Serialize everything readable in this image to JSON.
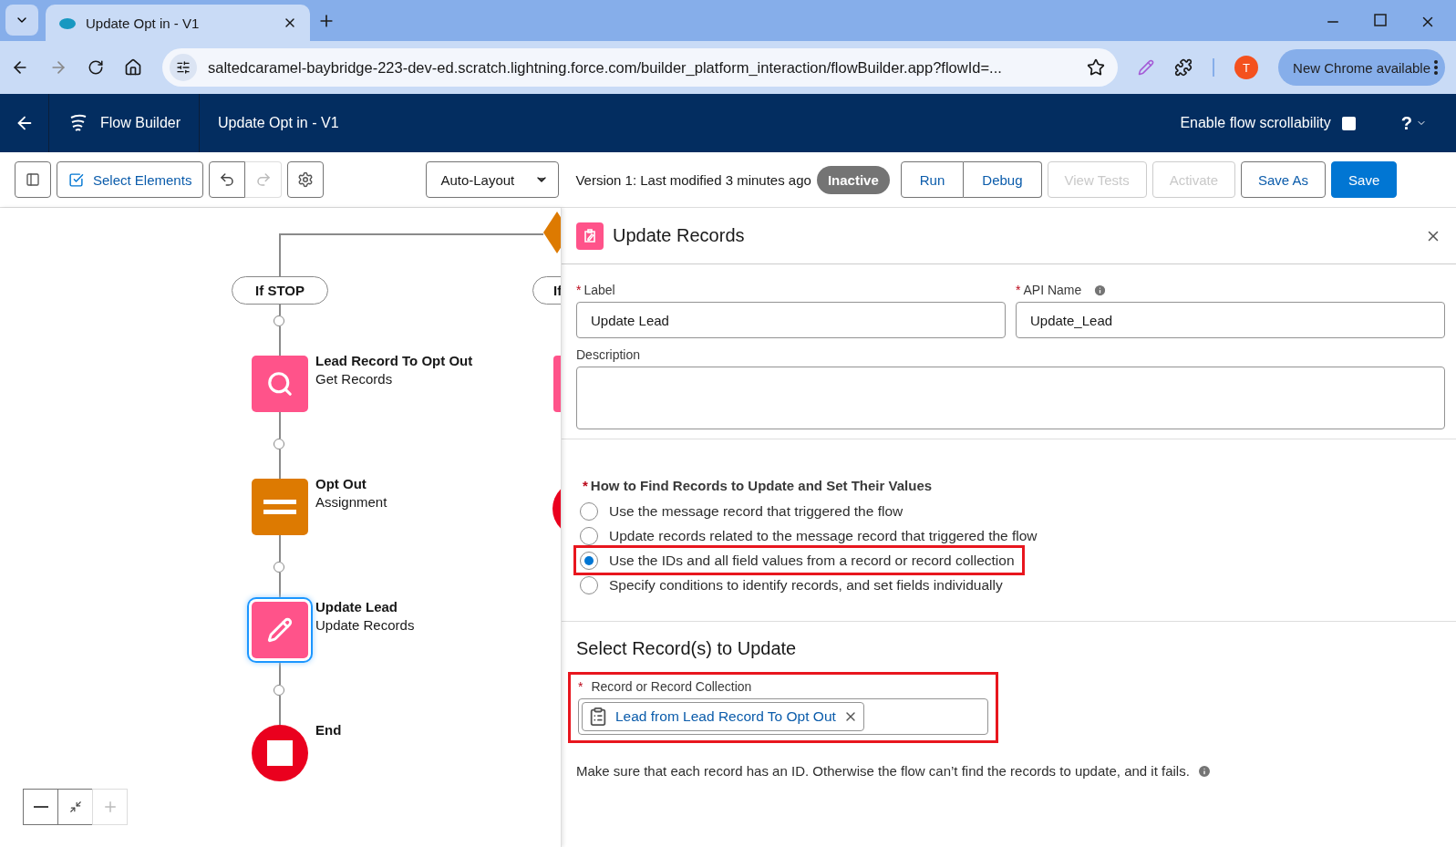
{
  "browser": {
    "tabs": [
      {
        "title": "Update Opt in - V1",
        "selected": true
      }
    ],
    "url": "saltedcaramel-baybridge-223-dev-ed.scratch.lightning.force.com/builder_platform_interaction/flowBuilder.app?flowId=...",
    "profile_initial": "T",
    "update_button": "New Chrome available"
  },
  "app_header": {
    "product": "Flow Builder",
    "flow_title": "Update Opt in - V1",
    "scrollability": {
      "label": "Enable flow scrollability",
      "checked": false
    },
    "help": "?"
  },
  "toolbar": {
    "select_elements": "Select Elements",
    "redo_disabled": true,
    "layout": "Auto-Layout",
    "version": "Version 1: Last modified 3 minutes ago",
    "status": "Inactive",
    "run_group": [
      "Run",
      "Debug"
    ],
    "actions": [
      {
        "label": "View Tests",
        "kind": "disabled"
      },
      {
        "label": "Activate",
        "kind": "disabled"
      },
      {
        "label": "Save As",
        "kind": "outline"
      },
      {
        "label": "Save",
        "kind": "primary"
      }
    ]
  },
  "canvas": {
    "branches": [
      {
        "label": "If STOP"
      },
      {
        "label": "If"
      }
    ],
    "nodes": [
      {
        "kind": "get",
        "title": "Lead Record To Opt Out",
        "subtitle": "Get Records",
        "selected": false
      },
      {
        "kind": "assignment",
        "title": "Opt Out",
        "subtitle": "Assignment",
        "selected": false
      },
      {
        "kind": "update",
        "title": "Update Lead",
        "subtitle": "Update Records",
        "selected": true
      },
      {
        "kind": "end",
        "title": "End",
        "selected": false
      }
    ],
    "zoom_in_disabled": true
  },
  "panel": {
    "title": "Update Records",
    "label_field": {
      "required_mark": "*",
      "label": "Label",
      "value": "Update Lead"
    },
    "api_name_field": {
      "required_mark": "*",
      "label": "API Name",
      "value": "Update_Lead"
    },
    "description_field": {
      "label": "Description"
    },
    "find_records": {
      "required_mark": "*",
      "label": "How to Find Records to Update and Set Their Values",
      "options": [
        {
          "label": "Use the message record that triggered the flow",
          "selected": false,
          "highlighted": false
        },
        {
          "label": "Update records related to the message record that triggered the flow",
          "selected": false,
          "highlighted": false
        },
        {
          "label": "Use the IDs and all field values from a record or record collection",
          "selected": true,
          "highlighted": true
        },
        {
          "label": "Specify conditions to identify records, and set fields individually",
          "selected": false,
          "highlighted": false
        }
      ]
    },
    "select_section": {
      "heading": "Select Record(s) to Update",
      "required_mark": "*",
      "field_label": "Record or Record Collection",
      "pill": "Lead from Lead Record To Opt Out",
      "highlighted": true
    },
    "note": "Make sure that each record has an ID. Otherwise the flow can’t find the records to update, and it fails."
  }
}
